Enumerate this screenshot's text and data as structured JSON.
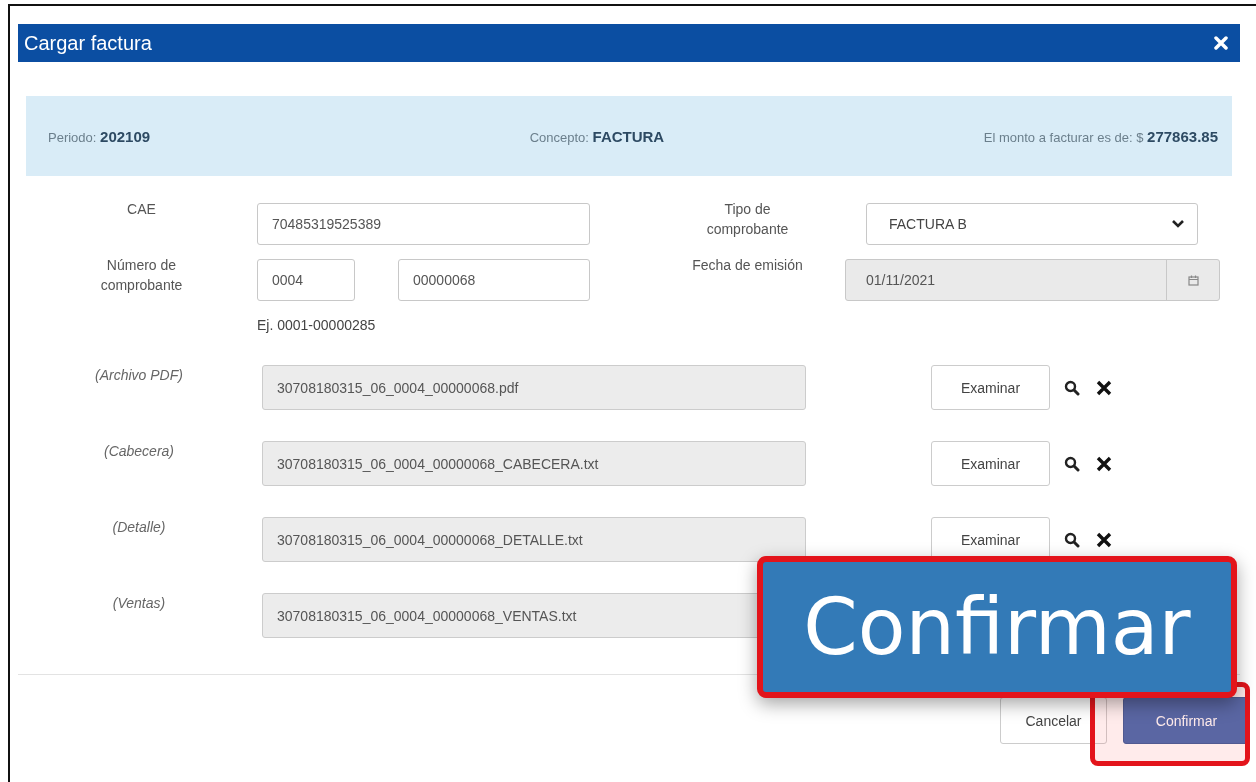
{
  "dialog": {
    "title": "Cargar factura"
  },
  "summary": [
    {
      "kind": "left",
      "text": "Periodo: **202109**"
    },
    {
      "kind": "center",
      "text": "Concepto: **FACTURA**"
    },
    {
      "kind": "right",
      "text": "El monto a facturar es de: $ **277863.85**"
    }
  ],
  "cae": {
    "label": "CAE",
    "value": "70485319525389"
  },
  "tipo": {
    "label": "Tipo de comprobante",
    "value": "FACTURA B"
  },
  "numero": {
    "label": "Número de comprobante",
    "value_1": "0004",
    "value_2": "00000068",
    "hint": "Ej. 0001-00000285"
  },
  "fecha": {
    "label": "Fecha de emisión",
    "value": "01/11/2021",
    "disabled": true
  },
  "files": [
    {
      "label": "(Archivo PDF)",
      "value": "30708180315_06_0004_00000068.pdf",
      "browse_button": "Examinar"
    },
    {
      "label": "(Cabecera)",
      "value": "30708180315_06_0004_00000068_CABECERA.txt",
      "browse_button": "Examinar"
    },
    {
      "label": "(Detalle)",
      "value": "30708180315_06_0004_00000068_DETALLE.txt",
      "browse_button": "Examinar"
    },
    {
      "label": "(Ventas)",
      "value": "30708180315_06_0004_00000068_VENTAS.txt"
    }
  ],
  "footer": {
    "cancel_button": "Cancelar",
    "confirm_button": "Confirmar"
  },
  "callout": {
    "text": "Confirmar"
  }
}
